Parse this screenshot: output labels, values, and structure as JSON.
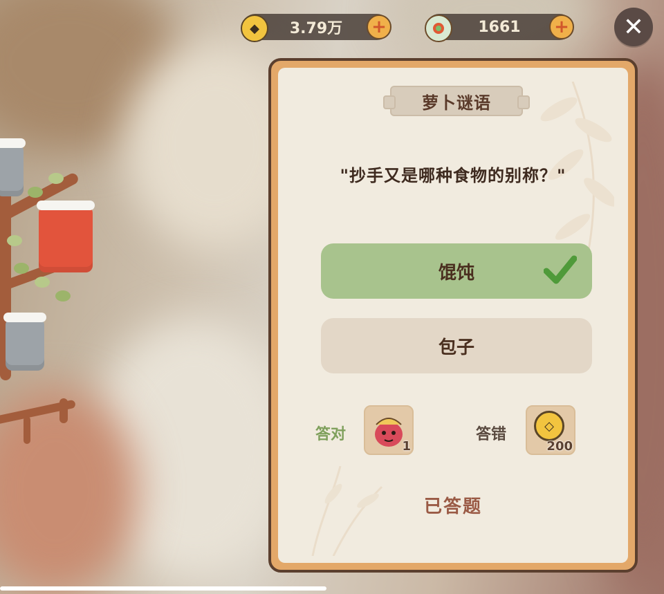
{
  "currencies": {
    "gold": {
      "icon": "gold-coin-icon",
      "value": "3.79万",
      "plus": "+"
    },
    "jade": {
      "icon": "jade-coin-icon",
      "value": "1661",
      "plus": "+"
    }
  },
  "close": {
    "icon": "close-icon",
    "label": "✕"
  },
  "panel": {
    "title": "萝卜谜语",
    "question": "\"抄手又是哪种食物的别称？\"",
    "options": [
      {
        "label": "馄饨",
        "state": "correct"
      },
      {
        "label": "包子",
        "state": "normal"
      }
    ],
    "rewards": {
      "correct_label": "答对",
      "correct_count": "1",
      "wrong_label": "答错",
      "wrong_count": "200"
    },
    "status": "已答题"
  },
  "colors": {
    "correct_green": "#a8c38d",
    "option_beige": "#e3d7c7",
    "panel_border": "#e3a869",
    "title_brown": "#5a3a2a"
  }
}
